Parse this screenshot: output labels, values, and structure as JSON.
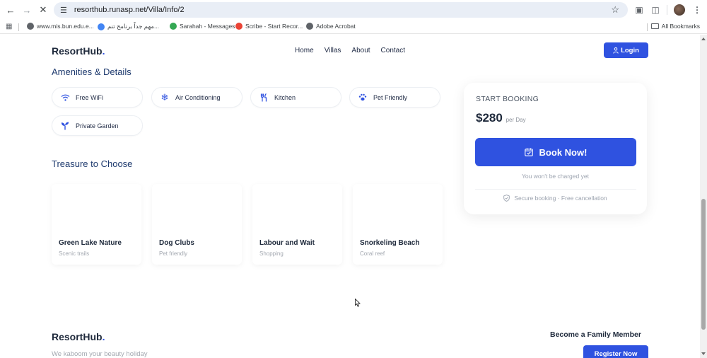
{
  "browser": {
    "url": "resorthub.runasp.net/Villa/Info/2",
    "bookmarks": [
      {
        "label": "www.mis.bun.edu.e...",
        "color": "#5f6368"
      },
      {
        "label": "مهم جداً برنامج تنم...",
        "color": "#4285f4"
      },
      {
        "label": "Sarahah - Messages",
        "color": "#34a853"
      },
      {
        "label": "Scribe - Start Recor...",
        "color": "#ea4335"
      },
      {
        "label": "Adobe Acrobat",
        "color": "#5f6368"
      }
    ],
    "all_bookmarks": "All Bookmarks"
  },
  "site": {
    "logo_main": "ResortHub",
    "logo_dot": ".",
    "nav": {
      "home": "Home",
      "villas": "Villas",
      "about": "About",
      "contact": "Contact"
    },
    "login": "Login"
  },
  "amenities": {
    "title": "Amenities & Details",
    "items": [
      {
        "label": "Free WiFi",
        "icon": "wifi-icon"
      },
      {
        "label": "Air Conditioning",
        "icon": "snowflake-icon"
      },
      {
        "label": "Kitchen",
        "icon": "utensils-icon"
      },
      {
        "label": "Pet Friendly",
        "icon": "paw-icon"
      },
      {
        "label": "Private Garden",
        "icon": "seedling-icon"
      }
    ]
  },
  "treasure": {
    "title": "Treasure to Choose",
    "places": [
      {
        "name": "Green Lake Nature",
        "sub": "Scenic trails"
      },
      {
        "name": "Dog Clubs",
        "sub": "Pet friendly"
      },
      {
        "name": "Labour and Wait",
        "sub": "Shopping"
      },
      {
        "name": "Snorkeling Beach",
        "sub": "Coral reef"
      }
    ]
  },
  "booking": {
    "label": "START BOOKING",
    "price": "$280",
    "per": "per Day",
    "button": "Book Now!",
    "note": "You won't be charged yet",
    "secure": "Secure booking · Free cancellation"
  },
  "footer": {
    "tagline": "We kaboom your beauty holiday",
    "family": "Become a Family Member",
    "register": "Register Now"
  },
  "colors": {
    "accent": "#2f52e0",
    "text_dark": "#1e293b"
  }
}
